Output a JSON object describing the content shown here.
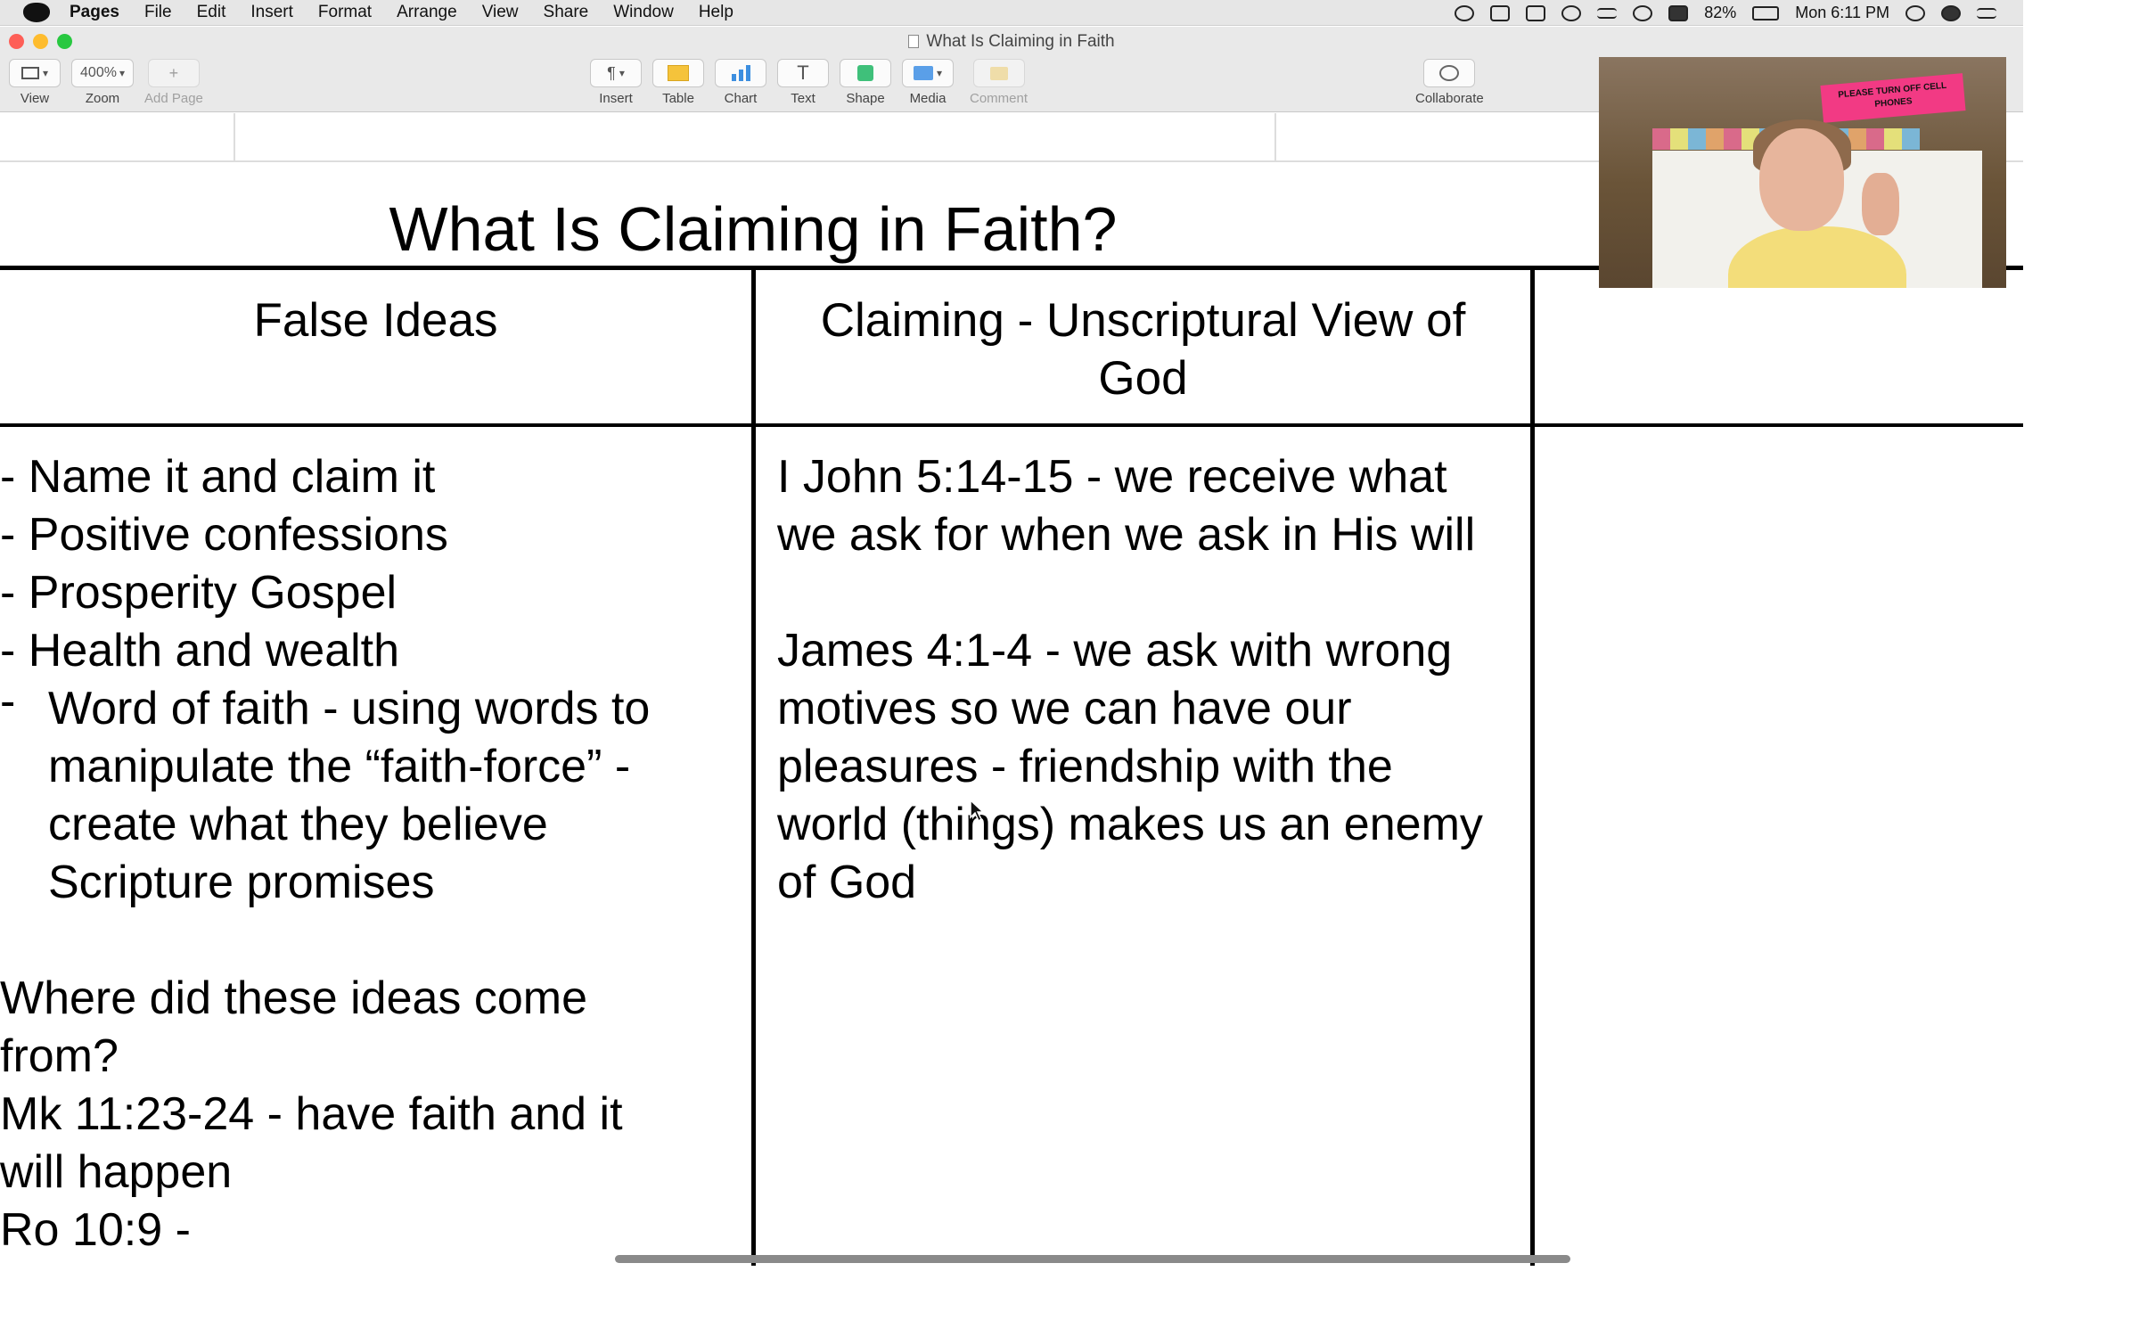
{
  "menubar": {
    "app_name": "Pages",
    "menus": [
      "File",
      "Edit",
      "Insert",
      "Format",
      "Arrange",
      "View",
      "Share",
      "Window",
      "Help"
    ],
    "battery": "82%",
    "clock": "Mon 6:11 PM"
  },
  "window": {
    "title": "What Is Claiming in Faith"
  },
  "toolbar": {
    "view_label": "View",
    "zoom_value": "400%",
    "zoom_label": "Zoom",
    "add_page_label": "Add Page",
    "insert_label": "Insert",
    "table_label": "Table",
    "chart_label": "Chart",
    "text_label": "Text",
    "shape_label": "Shape",
    "media_label": "Media",
    "comment_label": "Comment",
    "collaborate_label": "Collaborate"
  },
  "document": {
    "title": "What Is Claiming in Faith?",
    "columns": [
      {
        "header_lines": [
          "False Ideas"
        ]
      },
      {
        "header_lines": [
          "Claiming - Unscriptural View of",
          "God"
        ]
      }
    ],
    "left_lines": [
      "- Name it and claim it",
      "- Positive confessions",
      "- Prosperity Gospel",
      "- Health and wealth",
      "Word of faith - using words to",
      "manipulate the “faith-force” -",
      "create what they believe",
      "Scripture promises",
      "",
      "Where did these ideas come",
      "from?",
      "Mk 11:23-24 - have faith and it",
      "will happen",
      "Ro 10:9 -"
    ],
    "right_lines": [
      "I John 5:14-15 - we receive what",
      "we ask for when we ask in His will",
      "",
      "James 4:1-4 - we ask with wrong",
      "motives so we can have our",
      "pleasures - friendship with the",
      "world (things) makes us an enemy",
      "of God"
    ]
  },
  "webcam": {
    "sign_text": "PLEASE TURN OFF CELL PHONES"
  },
  "colors": {
    "accent_close": "#fe5f57",
    "accent_minimize": "#febc2e",
    "accent_zoom": "#28c840",
    "table_icon": "#f5c33b",
    "chart_icon": "#3d8fe0",
    "shape_icon": "#3fc07a"
  }
}
